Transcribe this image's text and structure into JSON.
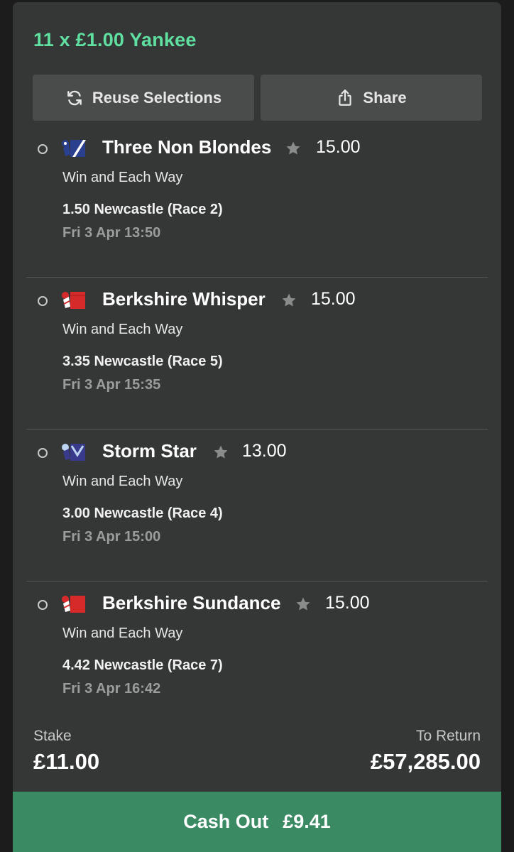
{
  "bet": {
    "title": "11 x £1.00 Yankee"
  },
  "actions": {
    "reuse_label": "Reuse Selections",
    "share_label": "Share"
  },
  "selections": [
    {
      "horse": "Three Non Blondes",
      "odds": "15.00",
      "market": "Win and Each Way",
      "race": "1.50 Newcastle (Race 2)",
      "time": "Fri 3 Apr 13:50",
      "silk_colors": [
        "#2b3f8f",
        "#ffffff"
      ]
    },
    {
      "horse": "Berkshire Whisper",
      "odds": "15.00",
      "market": "Win and Each Way",
      "race": "3.35 Newcastle (Race 5)",
      "time": "Fri 3 Apr 15:35",
      "silk_colors": [
        "#d62a2a",
        "#ffffff"
      ]
    },
    {
      "horse": "Storm Star",
      "odds": "13.00",
      "market": "Win and Each Way",
      "race": "3.00 Newcastle (Race 4)",
      "time": "Fri 3 Apr 15:00",
      "silk_colors": [
        "#3a3a8c",
        "#bcd4f0"
      ]
    },
    {
      "horse": "Berkshire Sundance",
      "odds": "15.00",
      "market": "Win and Each Way",
      "race": "4.42 Newcastle (Race 7)",
      "time": "Fri 3 Apr 16:42",
      "silk_colors": [
        "#d62a2a",
        "#ffffff"
      ]
    }
  ],
  "summary": {
    "stake_label": "Stake",
    "stake_value": "£11.00",
    "return_label": "To Return",
    "return_value": "£57,285.00"
  },
  "cashout": {
    "label": "Cash Out",
    "amount": "£9.41"
  },
  "colors": {
    "title_green": "#5fe0a0",
    "cashout_green": "#3a8a64",
    "card_bg": "#353736"
  }
}
